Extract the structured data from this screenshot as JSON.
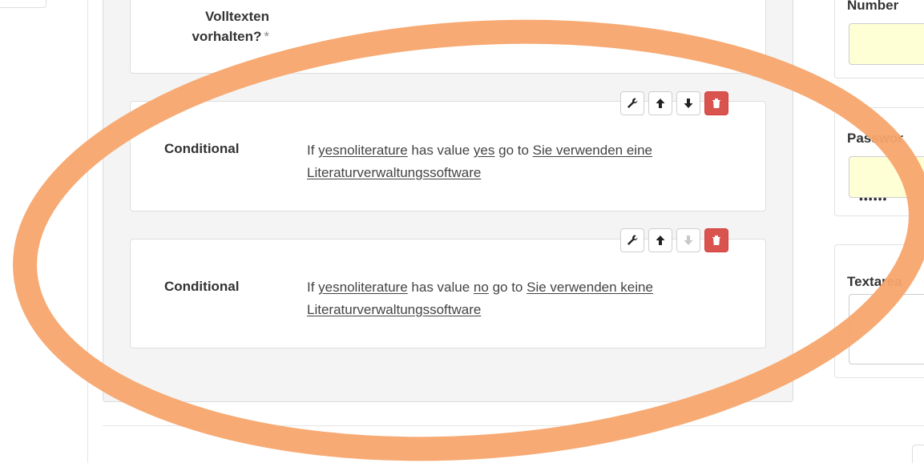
{
  "question_card": {
    "label_line1": "Volltexten",
    "label_line2": "vorhalten?",
    "required_mark": "*"
  },
  "conditionals": [
    {
      "label": "Conditional",
      "prefix": "If ",
      "field": "yesnoliterature",
      "mid": " has value ",
      "value": "yes",
      "goto": " go to ",
      "target": "Sie verwenden eine Literaturverwaltungssoftware",
      "toolbar": {
        "edit_icon": "wrench-icon",
        "up_icon": "arrow-up-icon",
        "down_icon": "arrow-down-icon",
        "down_disabled": false,
        "delete_icon": "trash-icon"
      }
    },
    {
      "label": "Conditional",
      "prefix": "If ",
      "field": "yesnoliterature",
      "mid": " has value ",
      "value": "no",
      "goto": " go to ",
      "target": "Sie verwenden keine Literaturverwaltungssoftware",
      "toolbar": {
        "edit_icon": "wrench-icon",
        "up_icon": "arrow-up-icon",
        "down_icon": "arrow-down-icon",
        "down_disabled": true,
        "delete_icon": "trash-icon"
      }
    }
  ],
  "right_panel": {
    "number_label": "Number",
    "password_label": "Passwor",
    "password_value": "••••••",
    "textarea_label": "Textarea"
  },
  "colors": {
    "annotation_ellipse": "#f7a56b",
    "danger": "#d9534f",
    "input_highlight": "#ffffd6"
  }
}
